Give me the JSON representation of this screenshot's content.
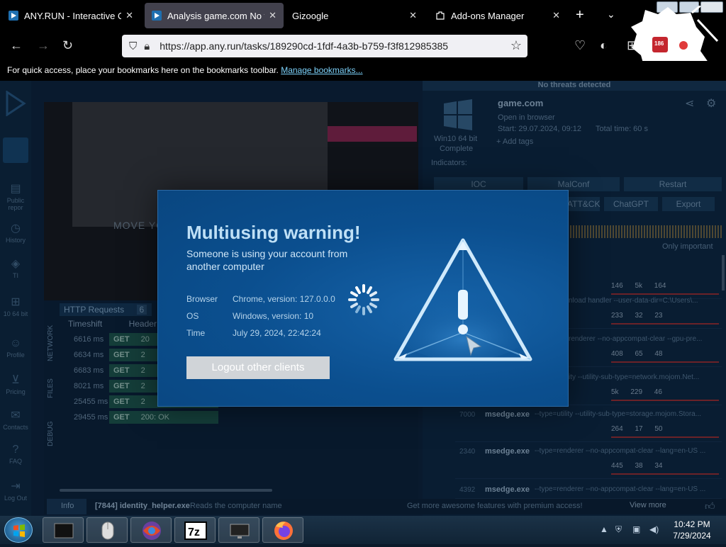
{
  "browser": {
    "tabs": [
      {
        "label": "ANY.RUN - Interactive Onli",
        "close": "✕",
        "active": false
      },
      {
        "label": "Analysis game.com No thre",
        "close": "✕",
        "active": true
      },
      {
        "label": "Gizoogle",
        "close": "✕",
        "active": false
      },
      {
        "label": "Add-ons Manager",
        "close": "✕",
        "active": false
      }
    ],
    "new_tab": "+",
    "tab_list": "⌄",
    "url": "https://app.any.run/tasks/189290cd-1fdf-4a3b-b759-f3f812985385",
    "bookmarks_text": "For quick access, place your bookmarks here on the bookmarks toolbar.",
    "bookmarks_link": "Manage bookmarks...",
    "badge_count": "186"
  },
  "anyrun": {
    "threat_status": "No threats detected",
    "task_title": "game.com",
    "open_in_browser": "Open in browser",
    "start": "Start: 29.07.2024, 09:12",
    "total_time": "Total time: 60 s",
    "os": "Win10 64 bit",
    "os_sub": "Complete",
    "add_tags": "Add tags",
    "indicators": "Indicators:",
    "buttons": {
      "ioc": "IOC",
      "malconf": "MalConf",
      "restart": "Restart",
      "attck": "ATT&CK",
      "chatgpt": "ChatGPT",
      "export": "Export"
    },
    "only_important": "Only important",
    "left_nav": [
      "Public repor",
      "History",
      "TI",
      "10 64 bit",
      "Profile",
      "Pricing",
      "Contacts",
      "FAQ",
      "Log Out"
    ],
    "move_text": "MOVE YO",
    "http_title": "HTTP Requests",
    "http_count": "6",
    "http_cols": [
      "Timeshift",
      "Header"
    ],
    "http_rows": [
      {
        "ts": "6616 ms",
        "method": "GET",
        "status": "20"
      },
      {
        "ts": "6634 ms",
        "method": "GET",
        "status": "2"
      },
      {
        "ts": "6683 ms",
        "method": "GET",
        "status": "2"
      },
      {
        "ts": "8021 ms",
        "method": "GET",
        "status": "2"
      },
      {
        "ts": "25455 ms",
        "method": "GET",
        "status": "2"
      },
      {
        "ts": "29455 ms",
        "method": "GET",
        "status": "200: OK"
      }
    ],
    "vtabs": [
      "NETWORK",
      "FILES",
      "DEBUG"
    ],
    "processes": [
      {
        "pid": "",
        "name": "",
        "args": "",
        "stats": "146 5k 164"
      },
      {
        "pid": "",
        "name": "",
        "args": "nload handler --user-data-dir=C:\\Users\\...",
        "stats": "233 32 23"
      },
      {
        "pid": "",
        "name": "",
        "args": "renderer --no-appcompat-clear --gpu-pre...",
        "stats": "408 65 48"
      },
      {
        "pid": "",
        "name": "",
        "args": "ity --utility-sub-type=network.mojom.Net...",
        "stats": "5k 229 46"
      },
      {
        "pid": "7000",
        "name": "msedge.exe",
        "args": "--type=utility --utility-sub-type=storage.mojom.Stora...",
        "stats": "264 17 50"
      },
      {
        "pid": "2340",
        "name": "msedge.exe",
        "args": "--type=renderer --no-appcompat-clear --lang=en-US ...",
        "stats": "445 38 34"
      },
      {
        "pid": "4392",
        "name": "msedge.exe",
        "args": "--type=renderer --no-appcompat-clear --lang=en-US ...",
        "stats": ""
      }
    ],
    "info_tab": "Info",
    "info_proc": "[7844] identity_helper.exe",
    "info_desc": "Reads the computer name",
    "promo": "Get more awesome features with premium access!",
    "view_more": "View more"
  },
  "modal": {
    "title": "Multiusing warning!",
    "subtitle": "Someone is using your account from another computer",
    "browser_label": "Browser",
    "browser_value": "Chrome, version: 127.0.0.0",
    "os_label": "OS",
    "os_value": "Windows, version: 10",
    "time_label": "Time",
    "time_value": "July 29, 2024, 22:42:24",
    "logout_label": "Logout other clients"
  },
  "taskbar": {
    "time": "10:42 PM",
    "date": "7/29/2024"
  }
}
